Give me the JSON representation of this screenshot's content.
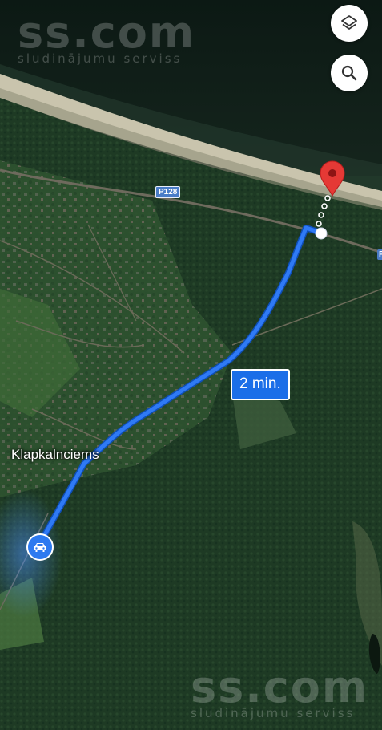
{
  "watermark": {
    "brand": "ss.com",
    "tagline": "sludinājumu serviss"
  },
  "route": {
    "duration": "2 min."
  },
  "map": {
    "place_name": "Klapkalnciems",
    "road_label": "P128",
    "road_label_cut": "P",
    "route_color": "#2f7af5",
    "destination_color": "#e53935"
  },
  "controls": {
    "layers_icon": "layers-icon",
    "search_icon": "search-icon"
  }
}
